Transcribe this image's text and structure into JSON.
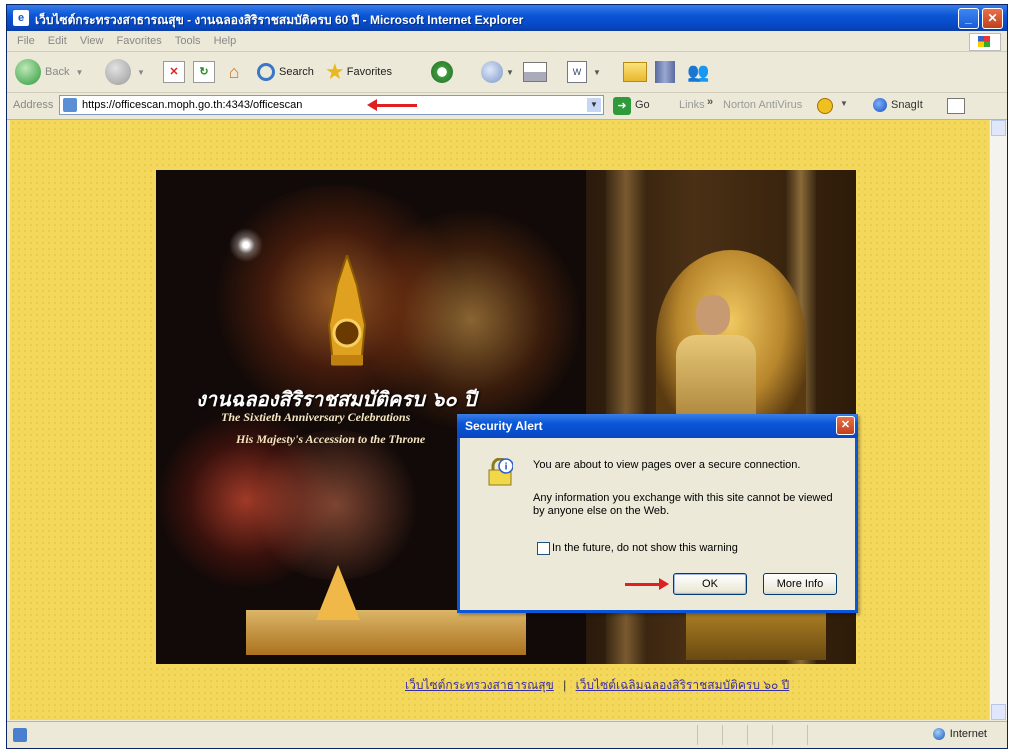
{
  "window": {
    "title": "เว็บไซต์กระทรวงสาธารณสุข - งานฉลองสิริราชสมบัติครบ 60 ปี - Microsoft Internet Explorer"
  },
  "menu": [
    "File",
    "Edit",
    "View",
    "Favorites",
    "Tools",
    "Help"
  ],
  "toolbar": {
    "back_label": "Back",
    "search_label": "Search",
    "favorites_label": "Favorites"
  },
  "addressbar": {
    "label": "Address",
    "url": "https://officescan.moph.go.th:4343/officescan",
    "go_label": "Go",
    "links_label": "Links",
    "norton_label": "Norton AntiVirus",
    "snagit_label": "SnagIt"
  },
  "banner": {
    "thai_title": "งานฉลองสิริราชสมบัติครบ ๖๐ ปี",
    "subtitle_line1": "The Sixtieth Anniversary Celebrations",
    "subtitle_line2": "His Majesty's Accession to the Throne"
  },
  "footer_links": {
    "link1": "เว็บไซต์กระทรวงสาธารณสุข",
    "separator": "|",
    "link2": "เว็บไซต์เฉลิมฉลองสิริราชสมบัติครบ ๖๐ ปี"
  },
  "dialog": {
    "title": "Security Alert",
    "message1": "You are about to view pages over a secure connection.",
    "message2": "Any information you exchange with this site cannot be viewed by anyone else on the Web.",
    "checkbox_label": "In the future, do not show this warning",
    "ok_label": "OK",
    "more_info_label": "More Info"
  },
  "statusbar": {
    "zone": "Internet"
  },
  "colors": {
    "xp_blue": "#0a56d6",
    "page_bg": "#f4d85c",
    "annotation_arrow": "#e02020"
  }
}
